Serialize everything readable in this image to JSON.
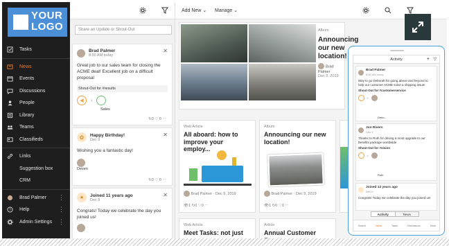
{
  "logo": {
    "line1": "YOUR",
    "line2": "LOGO"
  },
  "nav": {
    "items": [
      {
        "label": "Tasks",
        "icon": "check-square-icon"
      },
      {
        "label": "News",
        "icon": "newspaper-icon",
        "active": true
      },
      {
        "label": "Events",
        "icon": "calendar-icon"
      },
      {
        "label": "Discussions",
        "icon": "chat-icon"
      },
      {
        "label": "People",
        "icon": "people-icon"
      },
      {
        "label": "Library",
        "icon": "library-icon"
      },
      {
        "label": "Teams",
        "icon": "teams-icon"
      },
      {
        "label": "Classifieds",
        "icon": "classifieds-icon"
      },
      {
        "label": "Links",
        "icon": "link-icon"
      },
      {
        "label": "Suggestion box",
        "icon": ""
      },
      {
        "label": "CRM",
        "icon": ""
      },
      {
        "label": "Brad Palmer",
        "icon": "user-avatar-icon"
      },
      {
        "label": "Help",
        "icon": "help-icon"
      },
      {
        "label": "Admin Settings",
        "icon": "gear-icon"
      }
    ]
  },
  "feed": {
    "share_placeholder": "Share an Update or Shout-Out",
    "posts": [
      {
        "author": "Brad Palmer",
        "date": "8:50 AM today",
        "text": "Great job to our sales team for closing the ACME deal! Excellent job on a difficult proposal",
        "tag": "Shout-Out for #results",
        "group": "Sales",
        "likes": "0"
      },
      {
        "author": "Happy Birthday!",
        "date": "Dec 9",
        "text": "Wishing you a fantastic day!",
        "person": "Deven",
        "likes": "0"
      },
      {
        "author": "Joined 11 years ago",
        "date": "Dec 9",
        "text": "Congrats! Today we celebrate the day you joined us!"
      }
    ]
  },
  "toolbar": {
    "add_new": "Add New",
    "manage": "Manage"
  },
  "featured": {
    "label": "Album",
    "title": "Announcing our new location!",
    "author": "Brad Palmer",
    "date": "Dec 9, 2019"
  },
  "cards": [
    {
      "label": "Web Article",
      "title": "All aboard: how to improve your employ...",
      "author": "Brad Palmer",
      "date": "Dec 9, 2019"
    },
    {
      "label": "Album",
      "title": "Announcing our new location!",
      "author": "Brad Palmer",
      "date": "Dec 9, 2019"
    },
    {
      "label": "Web Article",
      "title": "Meet Tasks: not just",
      "author": "",
      "date": ""
    },
    {
      "label": "Article",
      "title": "Annual Customer Event",
      "author": "",
      "date": ""
    }
  ],
  "phone": {
    "title": "Activity",
    "posts": [
      {
        "name": "Brad Palmer",
        "date": "8:50 AM today",
        "text": "Way to go Deborah for going above and beyond to help our customer ACME solve a shipping issue!",
        "tag": "Shout-Out for #customerservice",
        "person": "Debo..."
      },
      {
        "name": "Jon Rivers",
        "date": "Dec 9",
        "text": "Thanks to Ruth for driving a most upgrade to our benefits package worldwide",
        "tag": "Shout-Out for #vision",
        "person": "Ruth"
      },
      {
        "name": "Joined 12 years ago",
        "date": "Dec 9",
        "text": "Congrats! Today we celebrate the day you joined us!"
      }
    ],
    "tabs": [
      "Activity",
      "News"
    ],
    "bottom_nav": [
      "Search",
      "News",
      "Tasks",
      "Discussions",
      "More"
    ]
  }
}
